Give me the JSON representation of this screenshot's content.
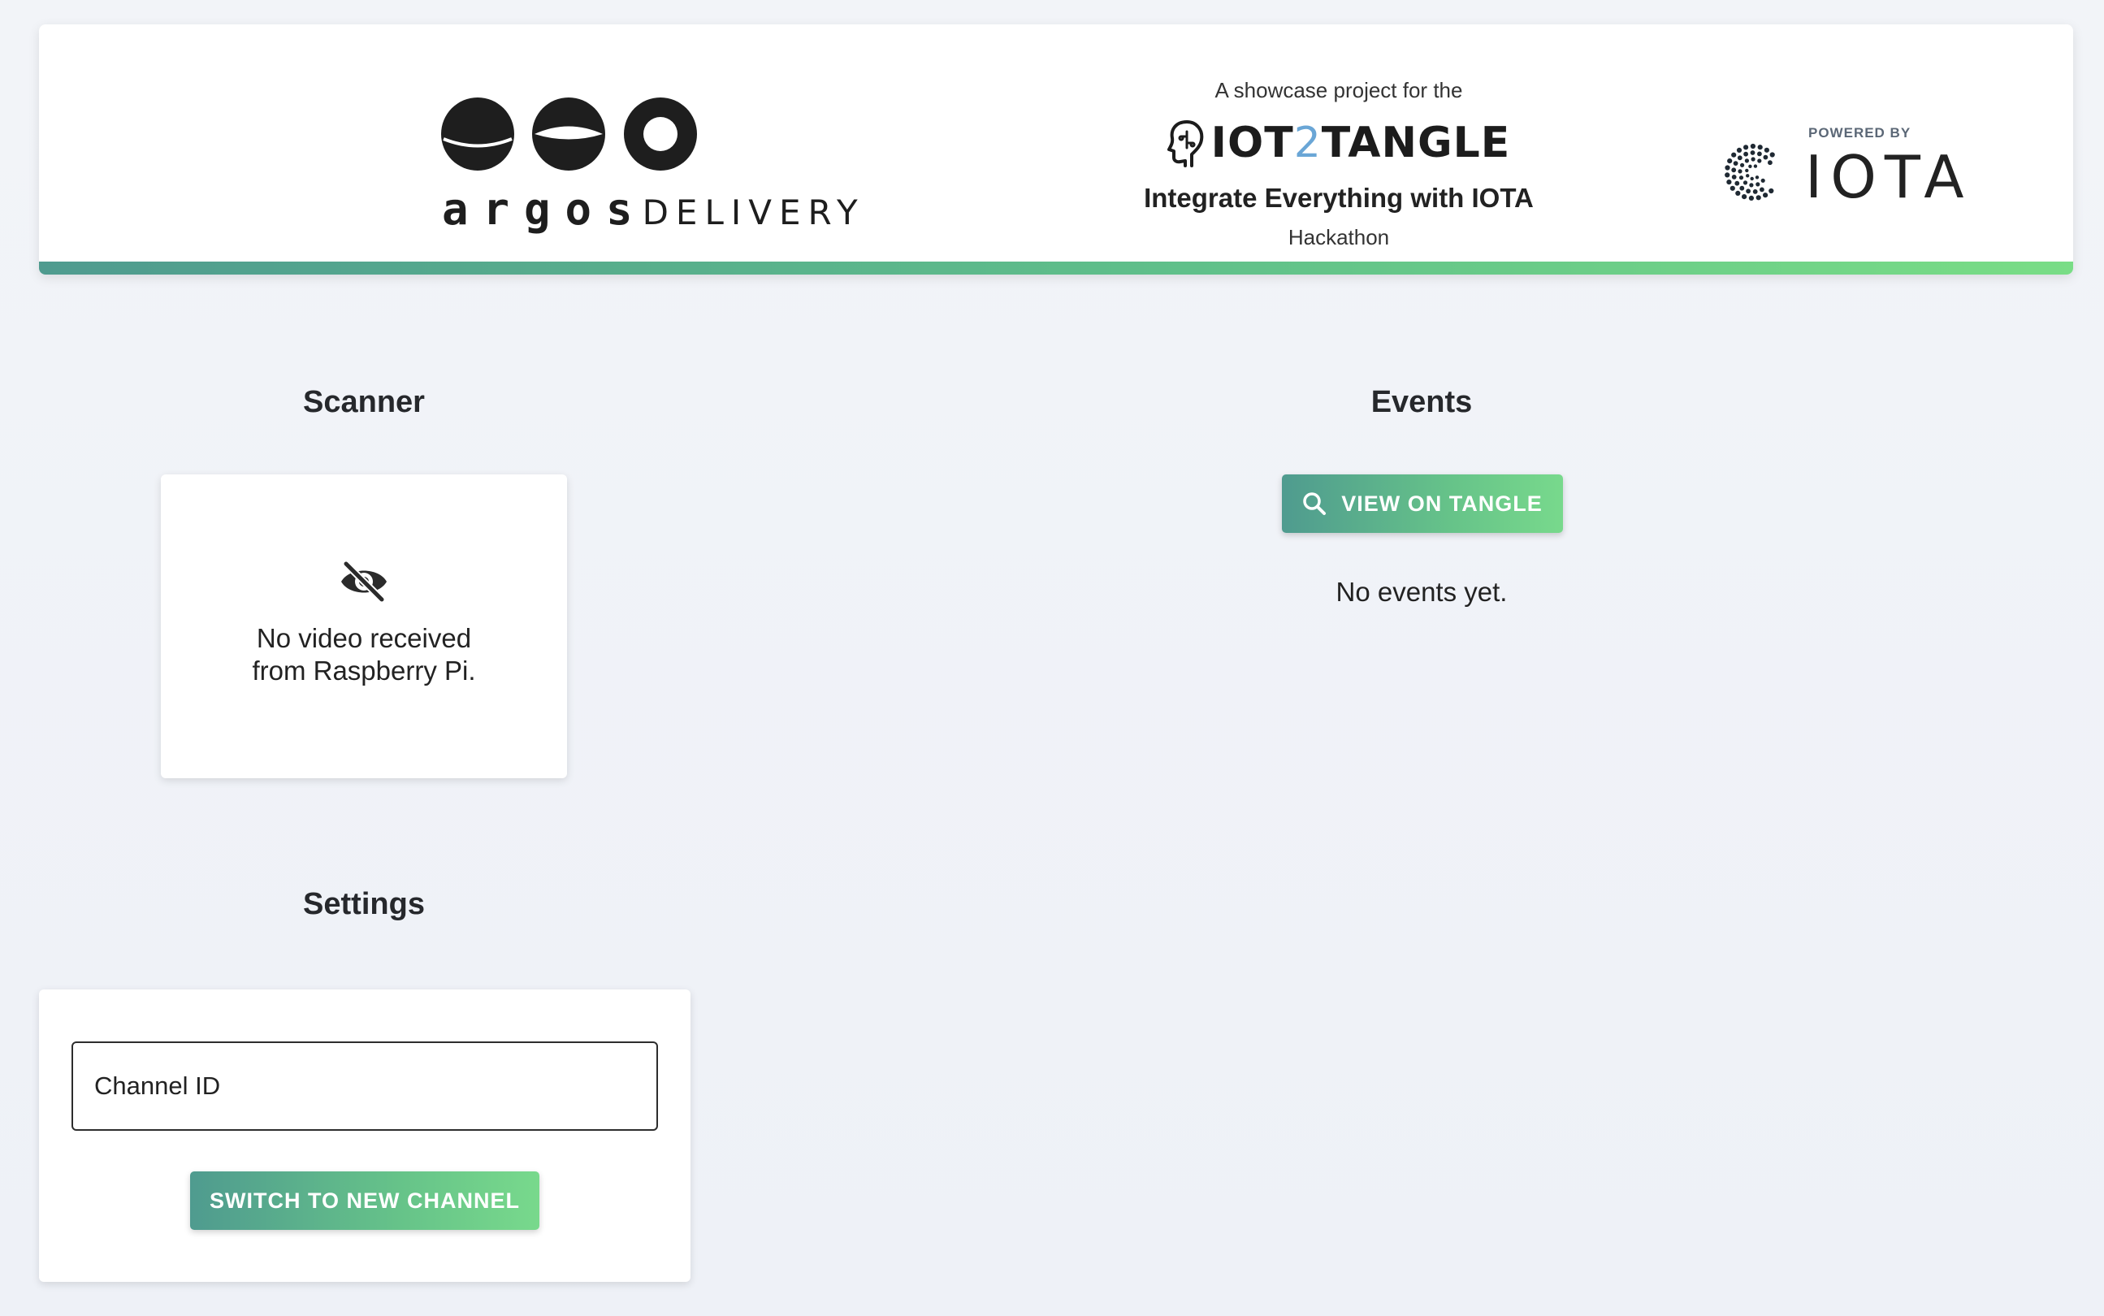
{
  "header": {
    "brand": {
      "word_primary": "argos",
      "word_secondary": "DELIVERY"
    },
    "hackathon": {
      "showcase_text": "A showcase project for the",
      "logo_text_a": "IOT",
      "logo_text_b": "2",
      "logo_text_c": "TANGLE",
      "tagline": "Integrate Everything with IOTA",
      "subtitle": "Hackathon"
    },
    "iota": {
      "powered_by": "POWERED BY",
      "word": "IOTA"
    },
    "accent_gradient": [
      "#4f9b8f",
      "#79dd86"
    ]
  },
  "scanner": {
    "title": "Scanner",
    "icon": "eye-off-icon",
    "message_line1": "No video received",
    "message_line2": "from Raspberry Pi."
  },
  "events": {
    "title": "Events",
    "view_button_label": "VIEW ON TANGLE",
    "view_button_icon": "search-icon",
    "empty_message": "No events yet."
  },
  "settings": {
    "title": "Settings",
    "channel_placeholder": "Channel ID",
    "channel_value": "",
    "switch_button_label": "SWITCH TO NEW CHANNEL"
  },
  "colors": {
    "button_gradient_start": "#4f9b8f",
    "button_gradient_end": "#78d98c",
    "background": "#f0f2f7"
  }
}
